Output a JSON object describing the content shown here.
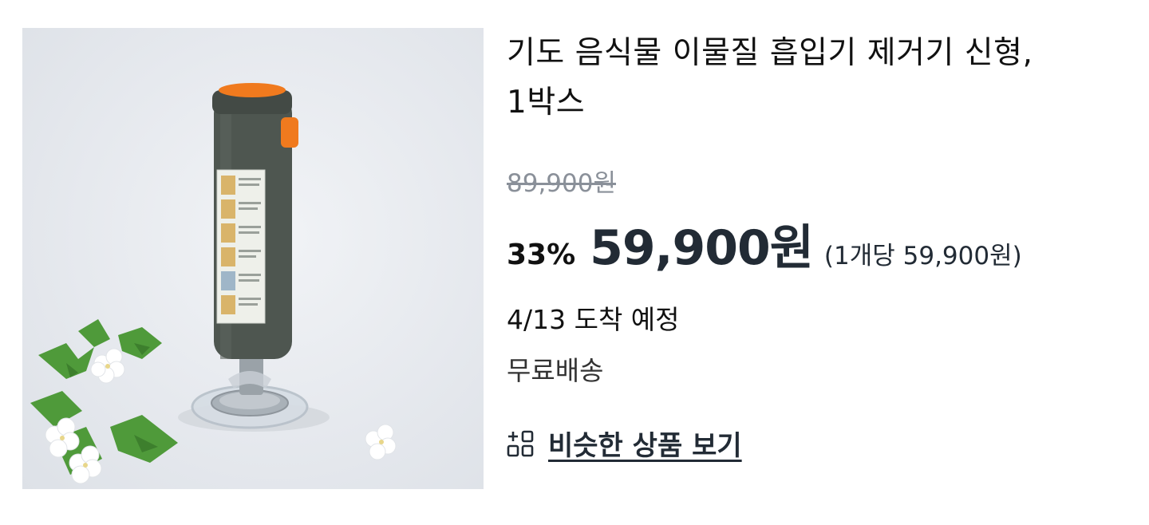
{
  "product": {
    "title_line1": "기도 음식물 이물질 흡입기 제거기 신형,",
    "title_line2": "1박스",
    "original_price": "89,900원",
    "discount_rate": "33%",
    "sale_price": "59,900원",
    "unit_price": "(1개당 59,900원)",
    "delivery_eta": "4/13 도착 예정",
    "shipping": "무료배송",
    "similar_link": "비슷한 상품 보기",
    "similar_icon": "grid-icon"
  },
  "colors": {
    "device_body": "#4e5650",
    "device_accent": "#f07a1e",
    "price_text": "#222b35",
    "strike_text": "#8a9099"
  }
}
